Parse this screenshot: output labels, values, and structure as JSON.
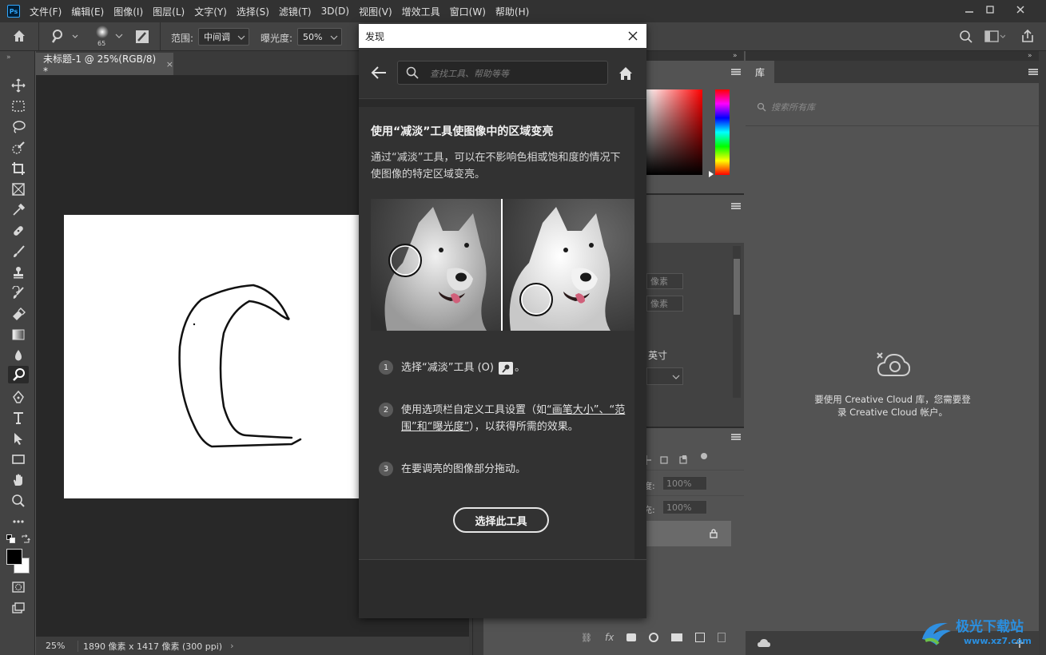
{
  "menubar": {
    "logo": "Ps",
    "items": [
      "文件(F)",
      "编辑(E)",
      "图像(I)",
      "图层(L)",
      "文字(Y)",
      "选择(S)",
      "滤镜(T)",
      "3D(D)",
      "视图(V)",
      "增效工具",
      "窗口(W)",
      "帮助(H)"
    ]
  },
  "options": {
    "brush_size": "65",
    "range_label": "范围:",
    "range_value": "中间调",
    "exposure_label": "曝光度:",
    "exposure_value": "50%"
  },
  "document": {
    "tab_title": "未标题-1 @ 25%(RGB/8) *",
    "zoom": "25%",
    "size_info": "1890 像素 x 1417 像素 (300 ppi)"
  },
  "dialog": {
    "title": "发现",
    "search_placeholder": "查找工具、帮助等等",
    "heading": "使用“减淡”工具使图像中的区域变亮",
    "description": "通过“减淡”工具，可以在不影响色相或饱和度的情况下使图像的特定区域变亮。",
    "steps": [
      {
        "num": "1",
        "text_a": "选择“减淡”工具 (O)",
        "text_b": "。"
      },
      {
        "num": "2",
        "text_a": "使用选项栏自定义工具设置（如",
        "link_a": "“画笔大小”、“范围”和“曝光度”",
        "text_b": "），以获得所需的效果。"
      },
      {
        "num": "3",
        "text_a": "在要调亮的图像部分拖动。"
      }
    ],
    "button_label": "选择此工具"
  },
  "mid_panel": {
    "field1": "像素",
    "field2": "像素",
    "unit_label": "英寸",
    "opacity_value": "100%",
    "fill_value": "100%",
    "opacity_suffix": "度:",
    "fill_suffix": "充:"
  },
  "library": {
    "tab_label": "库",
    "search_placeholder": "搜索所有库",
    "message": "要使用 Creative Cloud 库，您需要登录 Creative Cloud 帐户。"
  },
  "watermark": {
    "text": "极光下载站",
    "url": "www.xz7.com"
  },
  "colors": {
    "accent": "#31a8ff",
    "menubar_bg": "#323232",
    "panel_bg": "#535353",
    "dialog_bg": "#323232"
  }
}
